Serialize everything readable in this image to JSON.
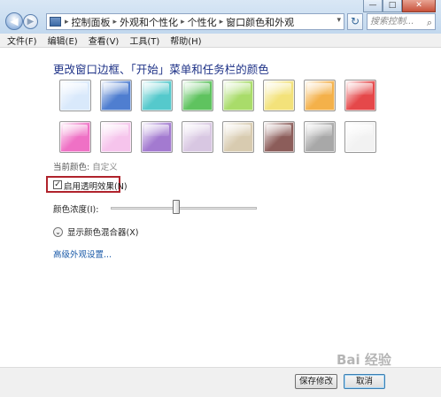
{
  "window": {
    "caption_buttons": [
      "—",
      "□",
      "✕"
    ]
  },
  "nav": {
    "back_icon": "◀",
    "forward_icon": "▶",
    "breadcrumb": [
      "控制面板",
      "外观和个性化",
      "个性化",
      "窗口颜色和外观"
    ],
    "search_placeholder": "搜索控制...",
    "refresh_icon": "↻"
  },
  "menubar": [
    {
      "label": "文件(F)"
    },
    {
      "label": "编辑(E)"
    },
    {
      "label": "查看(V)"
    },
    {
      "label": "工具(T)"
    },
    {
      "label": "帮助(H)"
    }
  ],
  "main": {
    "heading": "更改窗口边框、「开始」菜单和任务栏的颜色",
    "swatches": [
      {
        "name": "sky",
        "color": "#d9e9fb"
      },
      {
        "name": "twilight",
        "color": "#4f7ed0"
      },
      {
        "name": "sea",
        "color": "#55c9cc"
      },
      {
        "name": "leaf",
        "color": "#5fc35f"
      },
      {
        "name": "lime",
        "color": "#a9dc6a"
      },
      {
        "name": "pumpkin-light",
        "color": "#f3e27a"
      },
      {
        "name": "pumpkin",
        "color": "#f4b14a"
      },
      {
        "name": "ruby",
        "color": "#e5484a"
      },
      {
        "name": "fuchsia",
        "color": "#ef71c5"
      },
      {
        "name": "blush",
        "color": "#f6c4ec"
      },
      {
        "name": "violet",
        "color": "#a37ad0"
      },
      {
        "name": "lavender",
        "color": "#d8c7e2"
      },
      {
        "name": "taupe",
        "color": "#d8cbb0"
      },
      {
        "name": "chocolate",
        "color": "#8c5d5a"
      },
      {
        "name": "slate",
        "color": "#a8a8a8"
      },
      {
        "name": "frost",
        "color": "#f2f2f2"
      }
    ],
    "current_color_label": "当前颜色:",
    "current_color_value": "自定义",
    "transparency_label": "启用透明效果(N)",
    "transparency_checked": true,
    "transparency_check_mark": "✓",
    "intensity_label": "颜色浓度(I):",
    "intensity_value": 0.45,
    "mixer_icon": "⌄",
    "mixer_label": "显示颜色混合器(X)",
    "advanced_link": "高级外观设置..."
  },
  "footer": {
    "save_label": "保存修改",
    "cancel_label": "取消"
  },
  "watermark": "Bai 经验"
}
